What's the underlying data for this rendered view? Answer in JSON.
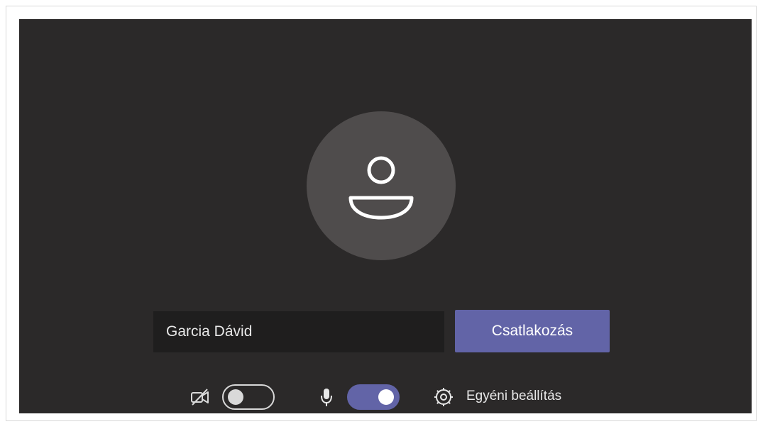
{
  "prejoin": {
    "name_value": "Garcia Dávid",
    "join_label": "Csatlakozás",
    "video_enabled": false,
    "mic_enabled": true,
    "settings_label": "Egyéni beállítás"
  },
  "colors": {
    "stage_background": "#2b2929",
    "avatar_background": "#4f4c4c",
    "accent": "#6264a7",
    "input_background": "#1f1e1e",
    "text": "#e8e8e8"
  },
  "icons": {
    "avatar": "person-icon",
    "camera": "camera-off-icon",
    "microphone": "microphone-icon",
    "settings": "gear-icon"
  }
}
